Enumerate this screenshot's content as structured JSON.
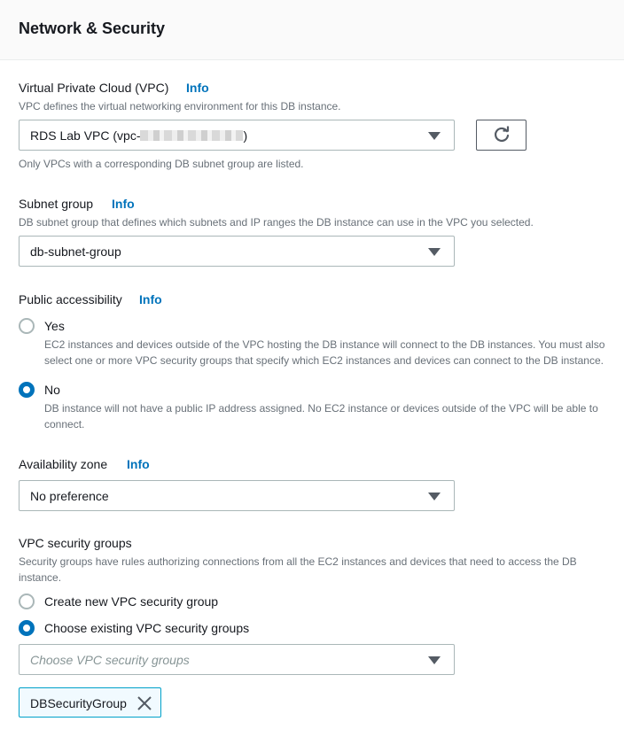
{
  "section": {
    "title": "Network & Security"
  },
  "vpc": {
    "label": "Virtual Private Cloud (VPC)",
    "info": "Info",
    "description": "VPC defines the virtual networking environment for this DB instance.",
    "value_prefix": "RDS Lab VPC (vpc-",
    "value_suffix": ")",
    "hint": "Only VPCs with a corresponding DB subnet group are listed.",
    "refresh_icon": "refresh-icon"
  },
  "subnet_group": {
    "label": "Subnet group",
    "info": "Info",
    "description": "DB subnet group that defines which subnets and IP ranges the DB instance can use in the VPC you selected.",
    "value": "db-subnet-group"
  },
  "public_accessibility": {
    "label": "Public accessibility",
    "info": "Info",
    "options": [
      {
        "label": "Yes",
        "description_line1": "EC2 instances and devices outside of the VPC hosting the DB instance will connect to the DB instances. You must also",
        "description_line2": "select one or more VPC security groups that specify which EC2 instances and devices can connect to the DB instance.",
        "checked": false
      },
      {
        "label": "No",
        "description_line1": "DB instance will not have a public IP address assigned. No EC2 instance or devices outside of the VPC will be able to",
        "description_line2": "connect.",
        "checked": true
      }
    ]
  },
  "availability_zone": {
    "label": "Availability zone",
    "info": "Info",
    "value": "No preference"
  },
  "vpc_security_groups": {
    "label": "VPC security groups",
    "description_line1": "Security groups have rules authorizing connections from all the EC2 instances and devices that need to access the DB",
    "description_line2": "instance.",
    "options": [
      {
        "label": "Create new VPC security group",
        "checked": false
      },
      {
        "label": "Choose existing VPC security groups",
        "checked": true
      }
    ],
    "placeholder": "Choose VPC security groups",
    "selected_tokens": [
      "DBSecurityGroup"
    ]
  },
  "colors": {
    "accent": "#0073bb",
    "token_border": "#00a1c9",
    "token_bg": "#f1faff"
  }
}
